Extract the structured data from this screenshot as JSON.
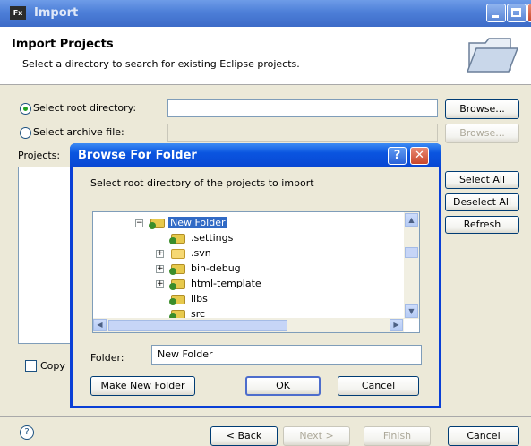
{
  "window": {
    "app_icon_label": "Fx",
    "title": "Import",
    "header_title": "Import Projects",
    "header_description": "Select a directory to search for existing Eclipse projects."
  },
  "source": {
    "root_label": "Select root directory:",
    "root_value": "",
    "root_selected": true,
    "archive_label": "Select archive file:",
    "archive_value": "",
    "browse_label": "Browse...",
    "browse_archive_label": "Browse..."
  },
  "projects": {
    "label": "Projects:",
    "select_all": "Select All",
    "deselect_all": "Deselect All",
    "refresh": "Refresh",
    "copy_checkbox_label": "Copy"
  },
  "footer": {
    "help_glyph": "?",
    "back": "< Back",
    "next": "Next >",
    "finish": "Finish",
    "cancel": "Cancel"
  },
  "dialog": {
    "title": "Browse For Folder",
    "help_glyph": "?",
    "close_glyph": "✕",
    "instruction": "Select root directory of the projects to import",
    "tree": [
      {
        "label": "New Folder",
        "expander": "minus",
        "folder": "project",
        "selected": true
      },
      {
        "label": ".settings",
        "expander": "none",
        "folder": "project"
      },
      {
        "label": ".svn",
        "expander": "plus",
        "folder": "plain"
      },
      {
        "label": "bin-debug",
        "expander": "plus",
        "folder": "project"
      },
      {
        "label": "html-template",
        "expander": "plus",
        "folder": "project"
      },
      {
        "label": "libs",
        "expander": "none",
        "folder": "project"
      },
      {
        "label": "src",
        "expander": "none",
        "folder": "project"
      }
    ],
    "folder_label": "Folder:",
    "folder_value": "New Folder",
    "make_new_folder": "Make New Folder",
    "ok": "OK",
    "cancel": "Cancel"
  }
}
